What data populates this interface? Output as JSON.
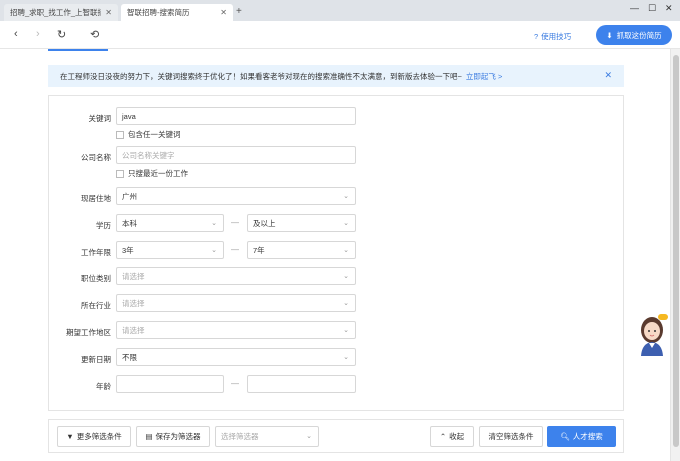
{
  "browser": {
    "tabs": [
      {
        "title": "招聘_求职_找工作_上智联招…",
        "active": false
      },
      {
        "title": "智联招聘-搜索简历",
        "active": true
      }
    ],
    "add_tab_glyph": "+",
    "window_controls": {
      "minimize": "—",
      "maximize": "☐",
      "close": "✕"
    },
    "nav": {
      "back": "‹",
      "forward": "›",
      "reload": "↻",
      "history": "⟲"
    },
    "help_label": "使用技巧",
    "grab_button_label": "抓取这份简历"
  },
  "notice": {
    "text": "在工程师没日没夜的努力下，关键词搜索终于优化了！如果看客老爷对现在的搜索准确性不太满意，到新版去体验一下吧~",
    "link_text": "立即起飞 >",
    "close": "✕"
  },
  "form": {
    "keyword": {
      "label": "关键词",
      "value": "java"
    },
    "any_keyword": {
      "label": "包含任一关键词"
    },
    "company": {
      "label": "公司名称",
      "placeholder": "公司名称关键字"
    },
    "recent_job_only": {
      "label": "只搜最近一份工作"
    },
    "residence": {
      "label": "现居住地",
      "value": "广州"
    },
    "education": {
      "label": "学历",
      "from": "本科",
      "to": "及以上"
    },
    "experience": {
      "label": "工作年限",
      "from": "3年",
      "to": "7年"
    },
    "job_category": {
      "label": "职位类别",
      "placeholder": "请选择"
    },
    "industry": {
      "label": "所在行业",
      "placeholder": "请选择"
    },
    "expected_location": {
      "label": "期望工作地区",
      "placeholder": "请选择"
    },
    "update_date": {
      "label": "更新日期",
      "value": "不限"
    },
    "age": {
      "label": "年龄",
      "from": "",
      "to": ""
    },
    "range_dash": "—"
  },
  "actions": {
    "more_filters": "更多筛选条件",
    "save_filter": "保存为筛选器",
    "select_filter_placeholder": "选择筛选器",
    "collapse": "收起",
    "clear": "清空筛选条件",
    "search": "人才搜索"
  },
  "colors": {
    "accent": "#3d82ec",
    "notice_bg": "#e8f3fd"
  }
}
